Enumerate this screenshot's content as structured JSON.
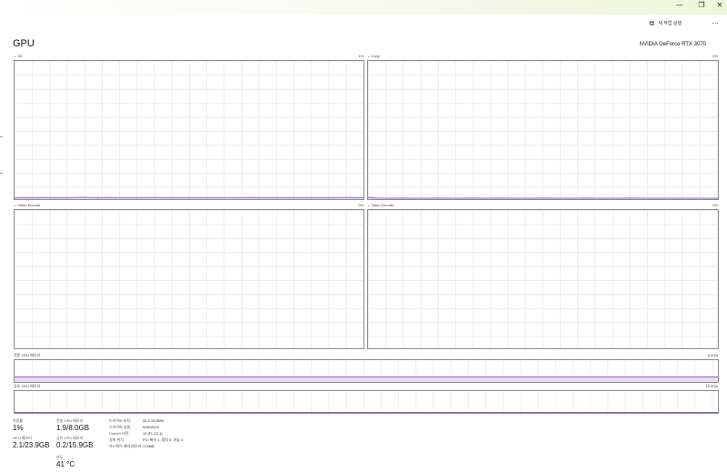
{
  "window": {
    "minimize_glyph": "—",
    "maximize_glyph": "❐",
    "close_glyph": "✕"
  },
  "toolbar": {
    "run_new_task_label": "새 작업 실행",
    "run_new_task_icon": "run-task-icon",
    "more_options_glyph": "⋯"
  },
  "header": {
    "title": "GPU",
    "device_name": "NVIDIA GeForce RTX 3070"
  },
  "colors": {
    "accent": "#8f5cc9",
    "memory_fill": "#e6dcf5",
    "border": "#8c8c8c",
    "grid": "#ececec"
  },
  "engines": [
    {
      "label": "3D",
      "max_label": "1%",
      "values": [
        0.2,
        0.4,
        0.3,
        0.5,
        0.4,
        0.4,
        0.3,
        0.5,
        0.6,
        0.4,
        0.4,
        0.5,
        0.3,
        0.4,
        0.4,
        0.4,
        0.5,
        0.4,
        0.3,
        0.4,
        0.4,
        0.4,
        0.4,
        0.3,
        0.4,
        0.4,
        0.4,
        0.5,
        0.4,
        0.4,
        0.4,
        0.4,
        0.4,
        0.4,
        0.3,
        0.4,
        0.4,
        0.4,
        0.5,
        0.4,
        0.4
      ]
    },
    {
      "label": "Copy",
      "max_label": "0%",
      "values": [
        0.5,
        0.1,
        0.0,
        0.0,
        0.1,
        0.0,
        0.0,
        0.0,
        0.1,
        0.0,
        0.0,
        0.0,
        0.1,
        0.0,
        0.0,
        0.1,
        0.0,
        0.0,
        0.0,
        0.0,
        0.1,
        0.0,
        0.0,
        0.0,
        0.0,
        0.1,
        0.0,
        0.0,
        0.0,
        0.0,
        0.1,
        0.0,
        0.0,
        0.0,
        0.0,
        0.0,
        0.0,
        0.0,
        0.0,
        0.0,
        0.0
      ]
    },
    {
      "label": "Video Encode",
      "max_label": "0%",
      "values": []
    },
    {
      "label": "Video Decode",
      "max_label": "0%",
      "values": []
    }
  ],
  "dedicated_memory_chart": {
    "label": "전용 GPU 메모리",
    "max_label": "8.0GB",
    "fraction": 0.24
  },
  "shared_memory_chart": {
    "label": "공유 GPU 메모리",
    "max_label": "15.9GB",
    "fraction": 0.013
  },
  "stats": {
    "utilization": {
      "label": "사용률",
      "value": "1%"
    },
    "gpu_memory": {
      "label": "GPU 메모리",
      "value": "2.1/23.9GB"
    },
    "dedicated_memory": {
      "label": "전용 GPU 메모리",
      "value": "1.9/8.0GB"
    },
    "shared_memory": {
      "label": "공유 GPU 메모리",
      "value": "0.2/15.9GB"
    },
    "temperature": {
      "label": "온도",
      "value": "41 °C"
    }
  },
  "details": [
    {
      "label": "드라이버 버전:",
      "value": "32.0.15.6590"
    },
    {
      "label": "드라이버 날짜:",
      "value": "9/26/2024"
    },
    {
      "label": "DirectX 버전:",
      "value": "12 (FL 12.1)"
    },
    {
      "label": "실제 위치:",
      "value": "PCI 버스 1, 장치 0, 기능 0"
    },
    {
      "label": "하드웨어 예약 메모리:",
      "value": "174MB"
    }
  ]
}
